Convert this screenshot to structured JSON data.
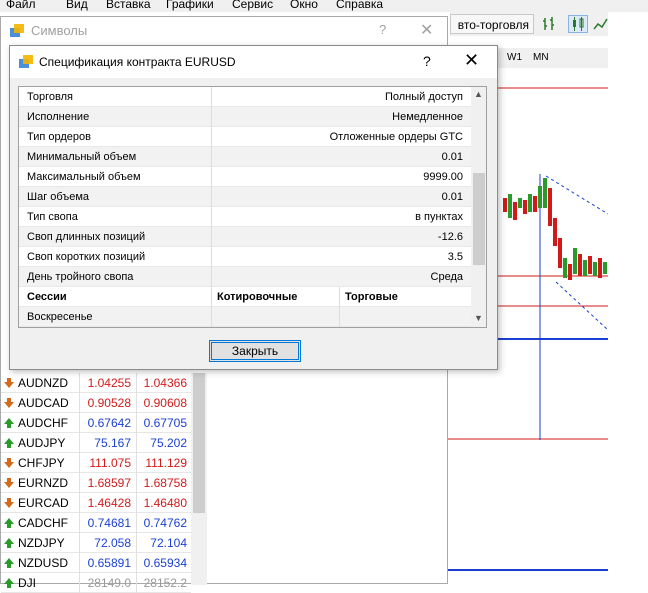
{
  "menu": [
    "Файл",
    "Вид",
    "Вставка",
    "Графики",
    "Сервис",
    "Окно",
    "Справка"
  ],
  "toolbar": {
    "autotrade_label": "вто-торговля"
  },
  "timeframes": [
    "W1",
    "MN"
  ],
  "symbols_window": {
    "title": "Символы",
    "help": "?",
    "close": "✕"
  },
  "quotes": [
    {
      "symbol": "AUDNZD",
      "bid": "1.04255",
      "ask": "1.04366",
      "dir": "down",
      "color": "down"
    },
    {
      "symbol": "AUDCAD",
      "bid": "0.90528",
      "ask": "0.90608",
      "dir": "down",
      "color": "down"
    },
    {
      "symbol": "AUDCHF",
      "bid": "0.67642",
      "ask": "0.67705",
      "dir": "up",
      "color": "up"
    },
    {
      "symbol": "AUDJPY",
      "bid": "75.167",
      "ask": "75.202",
      "dir": "up",
      "color": "up"
    },
    {
      "symbol": "CHFJPY",
      "bid": "111.075",
      "ask": "111.129",
      "dir": "down",
      "color": "down"
    },
    {
      "symbol": "EURNZD",
      "bid": "1.68597",
      "ask": "1.68758",
      "dir": "down",
      "color": "down"
    },
    {
      "symbol": "EURCAD",
      "bid": "1.46428",
      "ask": "1.46480",
      "dir": "down",
      "color": "down"
    },
    {
      "symbol": "CADCHF",
      "bid": "0.74681",
      "ask": "0.74762",
      "dir": "up",
      "color": "up"
    },
    {
      "symbol": "NZDJPY",
      "bid": "72.058",
      "ask": "72.104",
      "dir": "up",
      "color": "up"
    },
    {
      "symbol": "NZDUSD",
      "bid": "0.65891",
      "ask": "0.65934",
      "dir": "up",
      "color": "up"
    },
    {
      "symbol": "DJI",
      "bid": "28149.0",
      "ask": "28152.2",
      "dir": "up",
      "color": "gray"
    }
  ],
  "dialog": {
    "title": "Спецификация контракта EURUSD",
    "help": "?",
    "close": "✕",
    "rows": [
      {
        "key": "Торговля",
        "value": "Полный доступ"
      },
      {
        "key": "Исполнение",
        "value": "Немедленное"
      },
      {
        "key": "Тип ордеров",
        "value": "Отложенные ордеры GTC"
      },
      {
        "key": "Минимальный объем",
        "value": "0.01"
      },
      {
        "key": "Максимальный объем",
        "value": "9999.00"
      },
      {
        "key": "Шаг объема",
        "value": "0.01"
      },
      {
        "key": "Тип свопа",
        "value": "в пунктах"
      },
      {
        "key": "Своп длинных позиций",
        "value": "-12.6"
      },
      {
        "key": "Своп коротких позиций",
        "value": "3.5"
      },
      {
        "key": "День тройного свопа",
        "value": "Среда"
      }
    ],
    "sessions_header": {
      "c1": "Сессии",
      "c2": "Котировочные",
      "c3": "Торговые"
    },
    "session_rows": [
      {
        "day": "Воскресенье",
        "quote": "",
        "trade": ""
      }
    ],
    "close_button": "Закрыть"
  },
  "colors": {
    "up": "#1a3fd1",
    "down": "#d11a1a",
    "accent": "#0078d7"
  }
}
